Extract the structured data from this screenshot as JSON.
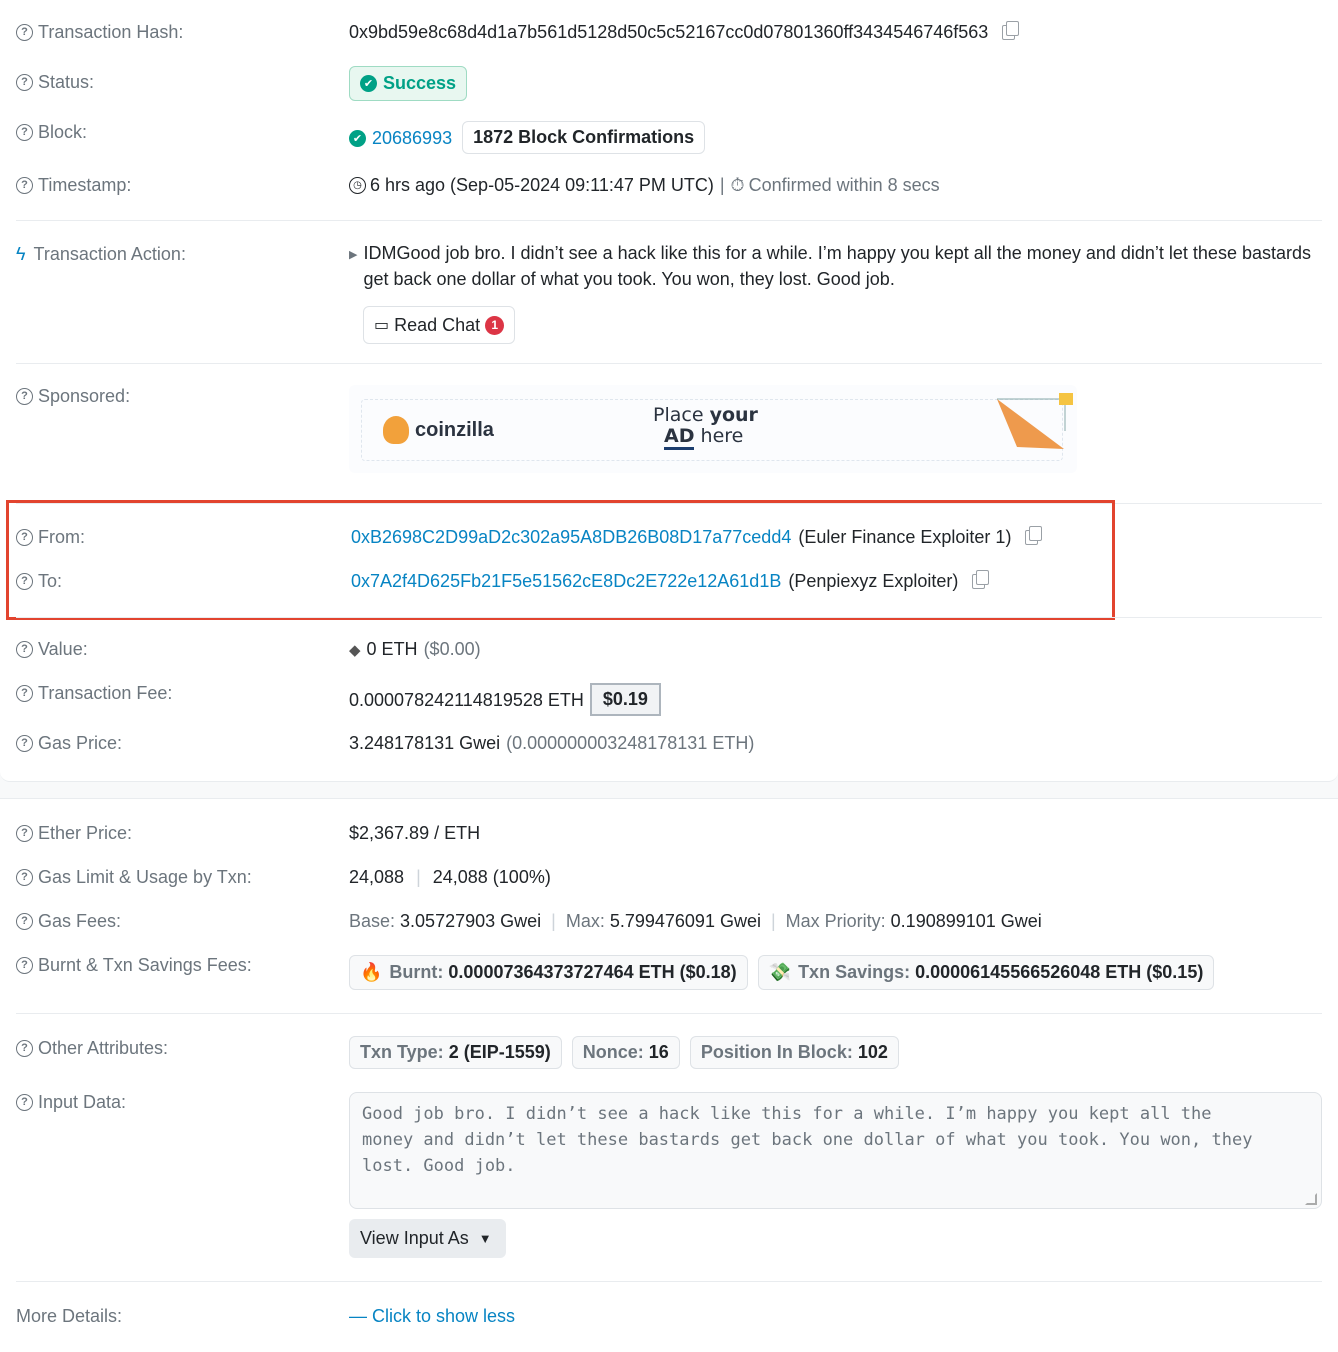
{
  "overview": {
    "tx_hash": {
      "label": "Transaction Hash:",
      "value": "0x9bd59e8c68d4d1a7b561d5128d50c5c52167cc0d07801360ff3434546746f563"
    },
    "status": {
      "label": "Status:",
      "value": "Success"
    },
    "block": {
      "label": "Block:",
      "number": "20686993",
      "confirmations": "1872 Block Confirmations"
    },
    "timestamp": {
      "label": "Timestamp:",
      "value": "6 hrs ago (Sep-05-2024 09:11:47 PM UTC)",
      "separator": "|",
      "confirmed": "Confirmed within 8 secs"
    },
    "action": {
      "label": "Transaction Action:",
      "prefix": "IDM",
      "message": "Good job bro. I didn’t see a hack like this for a while. I’m happy you kept all the money and didn’t let these bastards",
      "message2": "get back one dollar of what you took. You won, they lost. Good job.",
      "read_chat": "Read Chat",
      "chat_count": "1"
    },
    "sponsored": {
      "label": "Sponsored:",
      "brand": "coinzilla",
      "ad_line1_a": "Place ",
      "ad_line1_b": "your",
      "ad_line2_a": "AD",
      "ad_line2_b": " here"
    },
    "from": {
      "label": "From:",
      "address": "0xB2698C2D99aD2c302a95A8DB26B08D17a77cedd4",
      "name": "(Euler Finance Exploiter 1)"
    },
    "to": {
      "label": "To:",
      "address": "0x7A2f4D625Fb21F5e51562cE8Dc2E722e12A61d1B",
      "name": "(Penpiexyz Exploiter)"
    },
    "value": {
      "label": "Value:",
      "amount": "0 ETH",
      "usd": "($0.00)"
    },
    "fee": {
      "label": "Transaction Fee:",
      "amount": "0.000078242114819528 ETH",
      "usd": "$0.19"
    },
    "gas_price": {
      "label": "Gas Price:",
      "gwei": "3.248178131 Gwei",
      "eth": "(0.000000003248178131 ETH)"
    }
  },
  "more": {
    "ether_price": {
      "label": "Ether Price:",
      "value": "$2,367.89 / ETH"
    },
    "gas_limit": {
      "label": "Gas Limit & Usage by Txn:",
      "limit": "24,088",
      "sep": "|",
      "usage": "24,088 (100%)"
    },
    "gas_fees": {
      "label": "Gas Fees:",
      "base_label": "Base:",
      "base": "3.05727903 Gwei",
      "max_label": "Max:",
      "max": "5.799476091 Gwei",
      "priority_label": "Max Priority:",
      "priority": "0.190899101 Gwei",
      "sep": "|"
    },
    "burnt": {
      "label": "Burnt & Txn Savings Fees:",
      "burnt_label": "Burnt:",
      "burnt_value": "0.00007364373727464 ETH ($0.18)",
      "savings_label": "Txn Savings:",
      "savings_value": "0.00006145566526048 ETH ($0.15)"
    },
    "other": {
      "label": "Other Attributes:",
      "type_label": "Txn Type:",
      "type_value": "2 (EIP-1559)",
      "nonce_label": "Nonce:",
      "nonce_value": "16",
      "position_label": "Position In Block:",
      "position_value": "102"
    },
    "input": {
      "label": "Input Data:",
      "text": "Good job bro. I didn’t see a hack like this for a while. I’m happy you kept all the\nmoney and didn’t let these bastards get back one dollar of what you took. You won, they\nlost. Good job.",
      "view_as": "View Input As"
    },
    "details": {
      "label": "More Details:",
      "toggle": "— Click to show less"
    }
  },
  "colors": {
    "link": "#0784c3",
    "success": "#00a186",
    "highlight": "#e2442f",
    "muted": "#6c757d"
  }
}
